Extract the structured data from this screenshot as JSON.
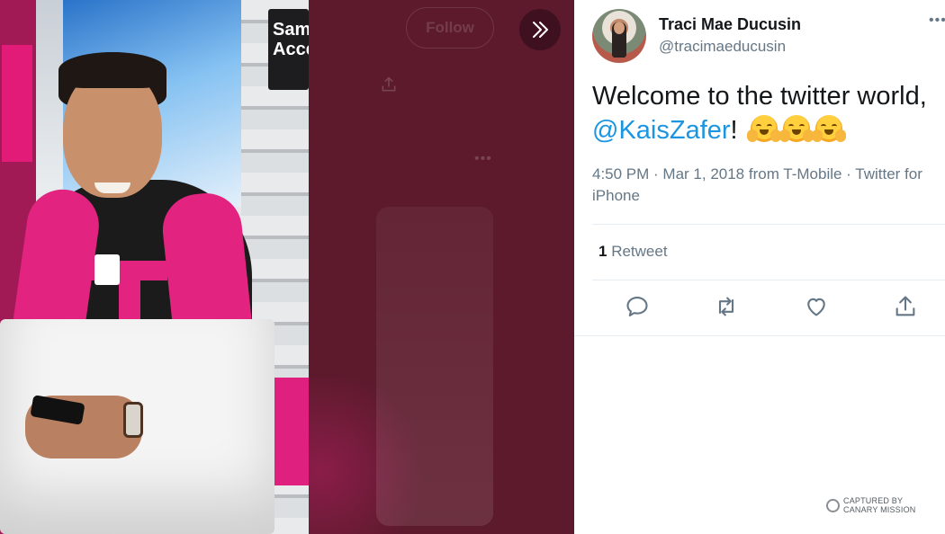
{
  "media": {
    "sign_text": "Sams\nAcce",
    "ghost_follow": "Follow"
  },
  "tweet": {
    "display_name": "Traci Mae Ducusin",
    "handle": "@tracimaeducusin",
    "text_before": "Welcome to the twitter world,",
    "mention": "@KaisZafer",
    "text_after": "!",
    "emoji_count": 3,
    "time": "4:50 PM · Mar 1, 2018 from T-Mobile · Twitter for iPhone",
    "retweet_count": "1",
    "retweet_label": "Retweet"
  },
  "actions": {
    "reply_icon": "reply-icon",
    "retweet_icon": "retweet-icon",
    "like_icon": "heart-icon",
    "share_icon": "share-icon"
  },
  "watermark": {
    "line1": "CAPTURED BY",
    "line2": "CANARY MISSION"
  },
  "colors": {
    "link": "#1b95e0",
    "secondary_text": "#657786",
    "brand_magenta": "#e2237f",
    "overlay": "#5c1a2c"
  }
}
